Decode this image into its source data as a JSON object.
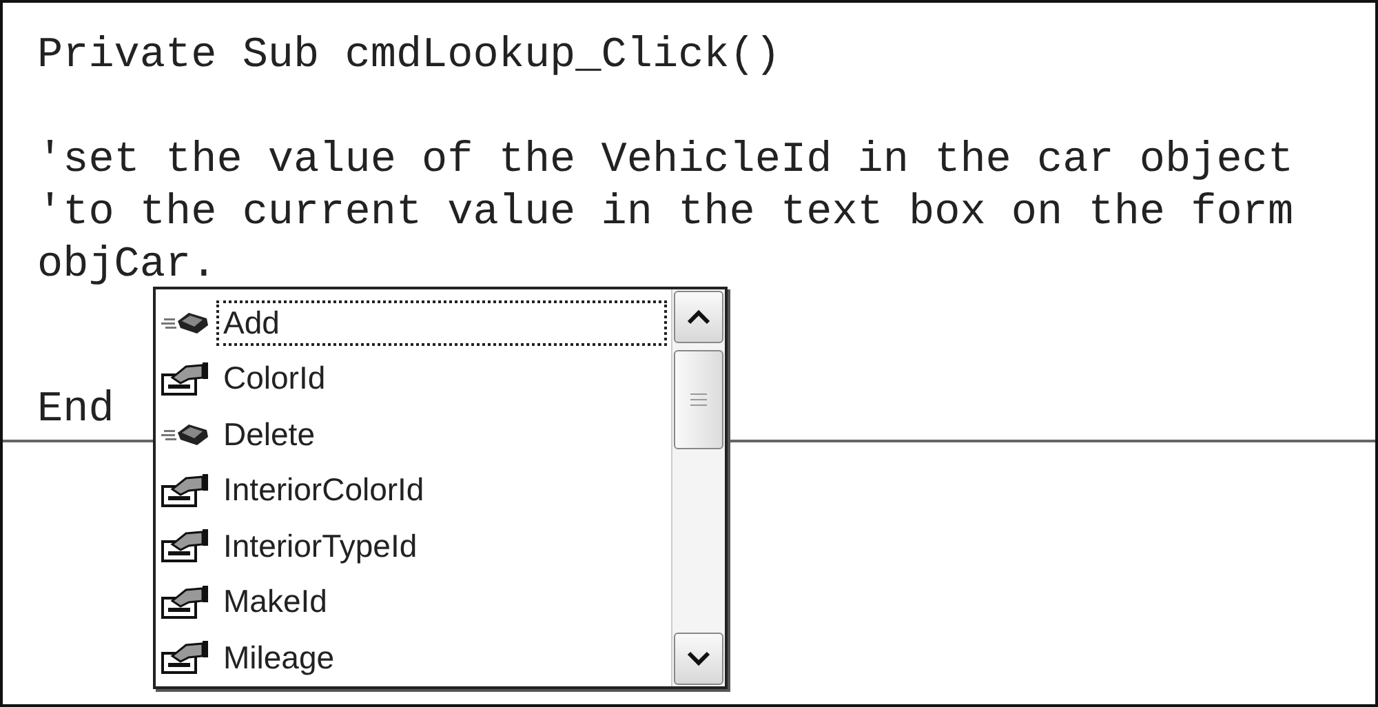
{
  "code_blocks": [
    [
      "Private Sub cmdLookup_Click()"
    ],
    [
      "'set the value of the VehicleId in the car object",
      "'to the current value in the text box on the form",
      "objCar."
    ]
  ],
  "end_line": "End",
  "completion_list": {
    "items": [
      {
        "label": "Add",
        "kind": "method",
        "selected": true
      },
      {
        "label": "ColorId",
        "kind": "property",
        "selected": false
      },
      {
        "label": "Delete",
        "kind": "method",
        "selected": false
      },
      {
        "label": "InteriorColorId",
        "kind": "property",
        "selected": false
      },
      {
        "label": "InteriorTypeId",
        "kind": "property",
        "selected": false
      },
      {
        "label": "MakeId",
        "kind": "property",
        "selected": false
      },
      {
        "label": "Mileage",
        "kind": "property",
        "selected": false
      }
    ]
  }
}
